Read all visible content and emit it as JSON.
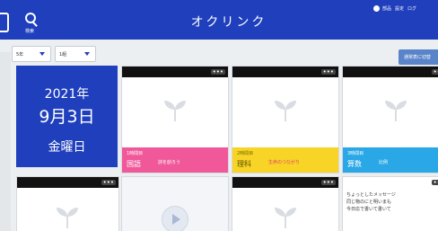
{
  "header": {
    "title": "オクリンク",
    "search_label": "検索",
    "user_items": [
      "部品",
      "設定",
      "ログ"
    ]
  },
  "filters": {
    "class_select": "5年",
    "grade_select": "1組",
    "switch_button": "通常表に切替"
  },
  "date_card": {
    "year": "2021年",
    "month_day": "9月3日",
    "weekday": "金曜日"
  },
  "lessons": [
    {
      "period": "1時間目",
      "subject": "国語",
      "topic": "詩を創ろう",
      "color": "#f0589a"
    },
    {
      "period": "2時間目",
      "subject": "理科",
      "topic": "生命のつながり",
      "color": "#f7d425"
    },
    {
      "period": "3時間目",
      "subject": "算数",
      "topic": "比例",
      "color": "#29a7e6"
    }
  ],
  "message_card": {
    "lines": [
      "ちょっとしたメッセージ",
      "同じ物のにと明いまも",
      "今日応で書いて書いて"
    ]
  },
  "more_label": "•••",
  "colors": {
    "header_blue": "#1f3fbd",
    "sprout": "#d9dde1"
  }
}
